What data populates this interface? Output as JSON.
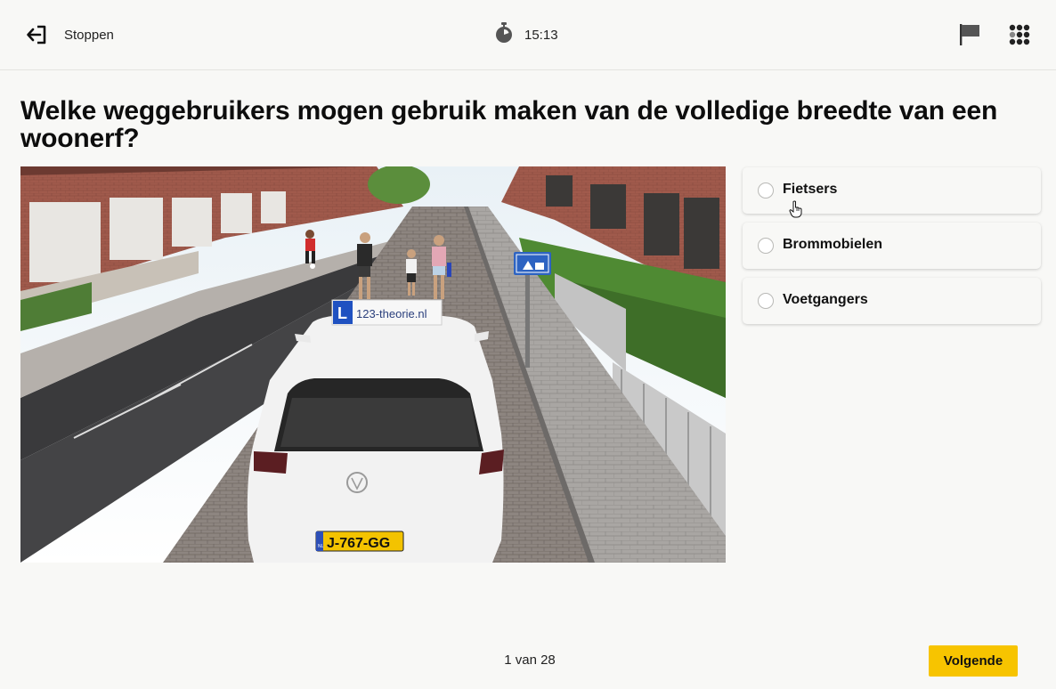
{
  "topbar": {
    "stop_label": "Stoppen",
    "stop_icon": "exit-arrow-icon",
    "timer_icon": "stopwatch-icon",
    "timer_value": "15:13",
    "flag_icon": "flag-icon",
    "overview_icon": "grid-dots-icon"
  },
  "question": {
    "text": "Welke weggebruikers mogen gebruik maken van de volledige breedte van een woonerf?"
  },
  "scene": {
    "car_roof_sign_letter": "L",
    "car_roof_sign_brand": "123-theorie.nl",
    "license_plate": "J-767-GG",
    "plate_country": "NL",
    "street_sign": "woonerf-sign"
  },
  "answers": [
    {
      "label": "Fietsers",
      "selected": false
    },
    {
      "label": "Brommobielen",
      "selected": false
    },
    {
      "label": "Voetgangers",
      "selected": false
    }
  ],
  "footer": {
    "pager_text": "1 van 28",
    "next_label": "Volgende"
  },
  "colors": {
    "accent": "#f7c400",
    "background": "#f8f8f6"
  }
}
